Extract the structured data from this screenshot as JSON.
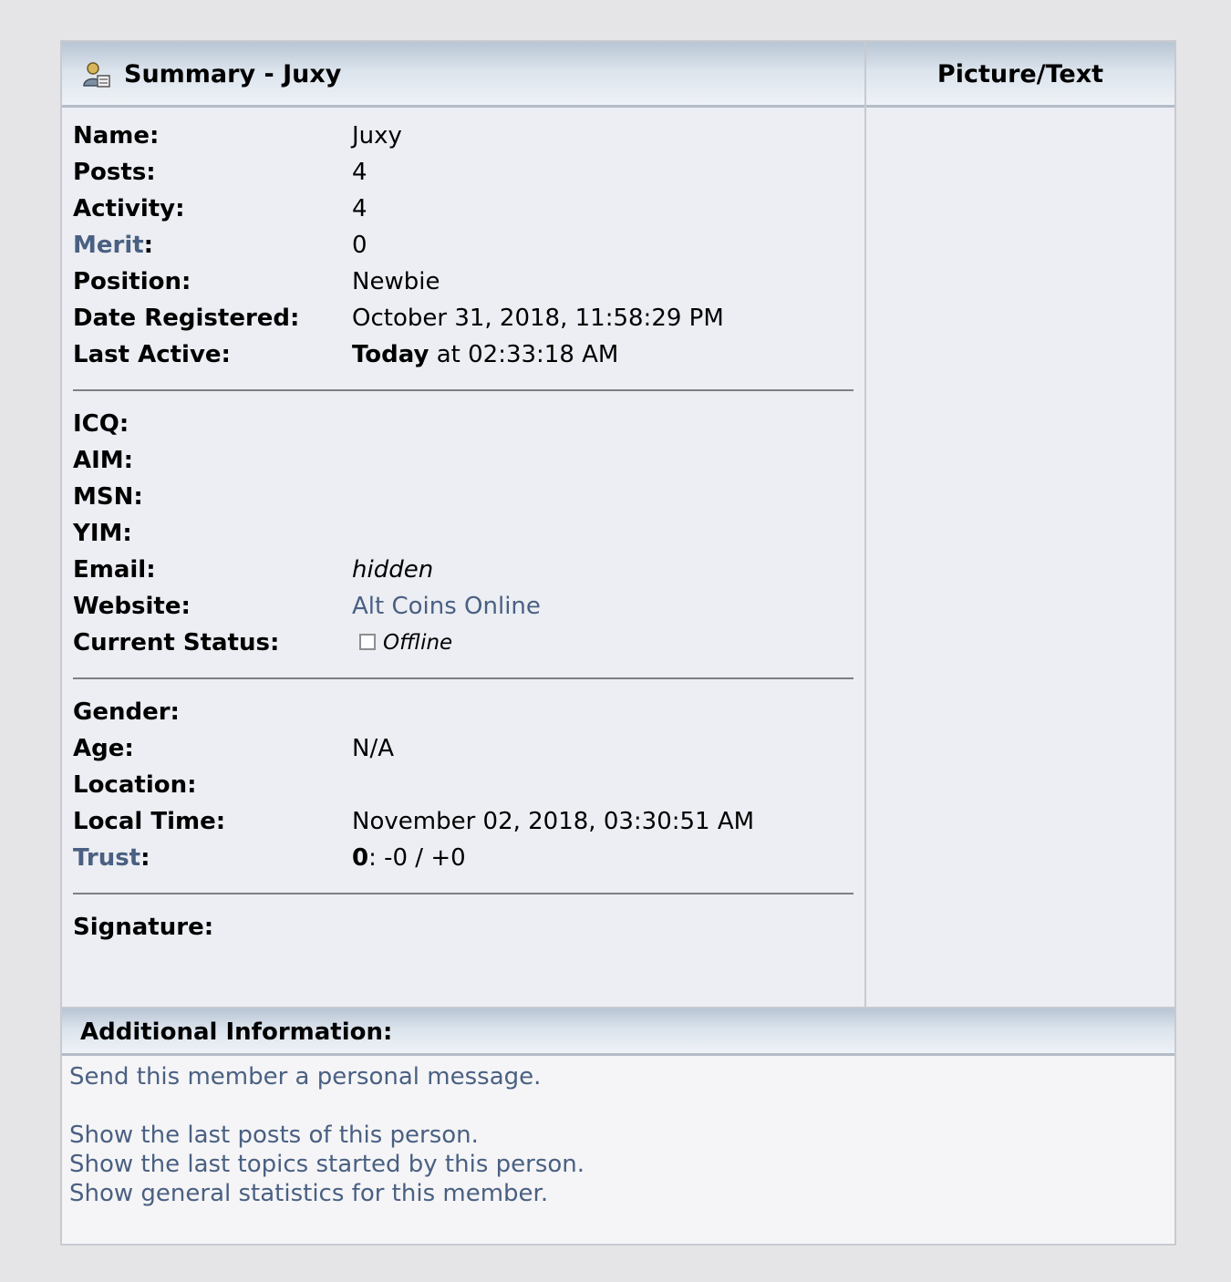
{
  "summary_header": "Summary - Juxy",
  "picture_header": "Picture/Text",
  "fields": {
    "name": {
      "label": "Name:",
      "value": "Juxy"
    },
    "posts": {
      "label": "Posts:",
      "value": "4"
    },
    "activity": {
      "label": "Activity:",
      "value": "4"
    },
    "merit": {
      "label": "Merit",
      "value": "0"
    },
    "position": {
      "label": "Position:",
      "value": "Newbie"
    },
    "date_registered": {
      "label": "Date Registered:",
      "value": "October 31, 2018, 11:58:29 PM"
    },
    "last_active": {
      "label": "Last Active:",
      "value_bold": "Today",
      "value_rest": " at 02:33:18 AM"
    },
    "icq": {
      "label": "ICQ:"
    },
    "aim": {
      "label": "AIM:"
    },
    "msn": {
      "label": "MSN:"
    },
    "yim": {
      "label": "YIM:"
    },
    "email": {
      "label": "Email:",
      "value": "hidden"
    },
    "website": {
      "label": "Website:",
      "value": "Alt Coins Online"
    },
    "current_status": {
      "label": "Current Status:",
      "value": "Offline"
    },
    "gender": {
      "label": "Gender:"
    },
    "age": {
      "label": "Age:",
      "value": "N/A"
    },
    "location": {
      "label": "Location:"
    },
    "local_time": {
      "label": "Local Time:",
      "value": "November 02, 2018, 03:30:51 AM"
    },
    "trust": {
      "label": "Trust",
      "value_bold": "0",
      "value_rest": ": -0 / +0"
    },
    "signature": {
      "label": "Signature:"
    }
  },
  "colon": ":",
  "additional": {
    "header": "Additional Information:",
    "links": [
      "Send this member a personal message.",
      "Show the last posts of this person.",
      "Show the last topics started by this person.",
      "Show general statistics for this member."
    ]
  },
  "icons": {
    "header_icon": "user-profile-icon",
    "status_icon": "offline-status-icon"
  },
  "colors": {
    "link": "#4a6082",
    "header_gradient_top": "#b8c5d4",
    "background": "#e5e5e8"
  }
}
